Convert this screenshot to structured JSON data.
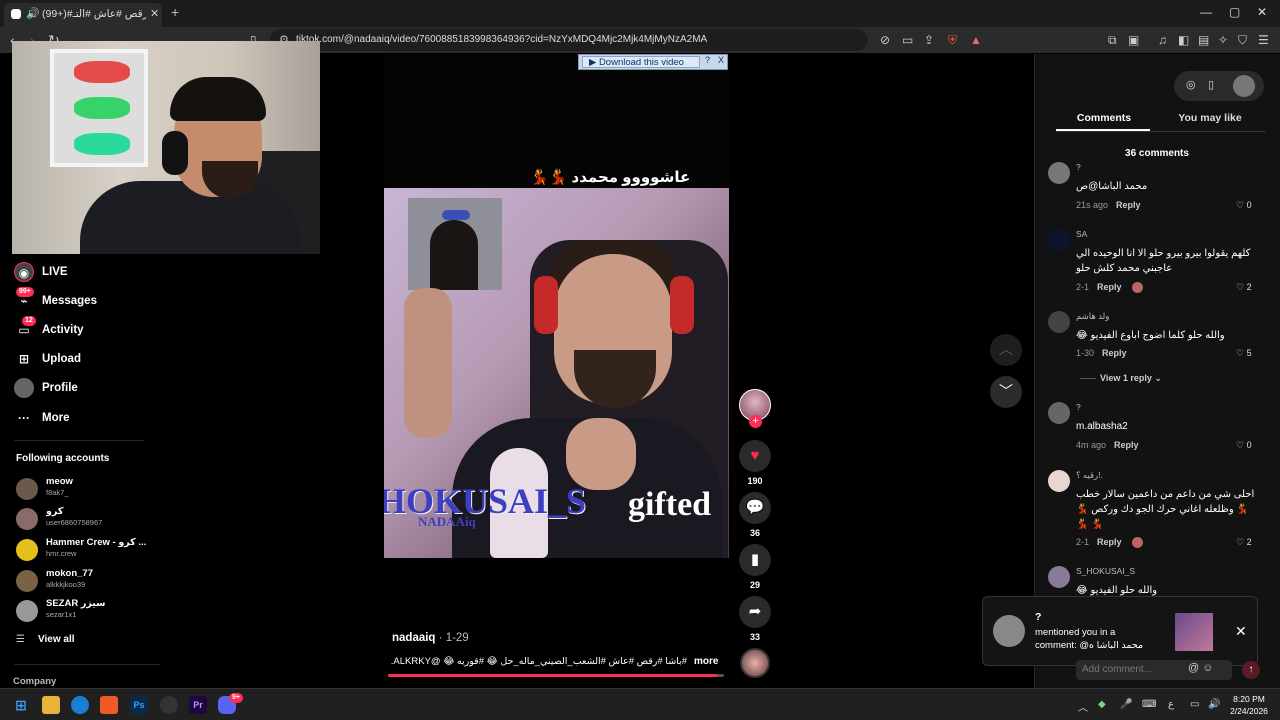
{
  "browser": {
    "tab_title": "(99+)#باشا #رقص #عاش #التـ",
    "new_tab_symbol": "+",
    "url": "tiktok.com/@nadaaiq/video/7600885183998364936?cid=NzYxMDQ4Mjc2Mjk4MjMyNzA2MA",
    "window_controls": [
      "—",
      "▢",
      "✕"
    ]
  },
  "download_bar": {
    "label": "▶ Download this video",
    "help": "?",
    "close": "X"
  },
  "sidebar": {
    "nav": [
      {
        "label": "LIVE",
        "icon": "live-icon"
      },
      {
        "label": "Messages",
        "icon": "messages-icon",
        "badge": "99+"
      },
      {
        "label": "Activity",
        "icon": "activity-icon",
        "badge": "12"
      },
      {
        "label": "Upload",
        "icon": "upload-icon"
      },
      {
        "label": "Profile",
        "icon": "profile-icon"
      },
      {
        "label": "More",
        "icon": "more-icon"
      }
    ],
    "following_heading": "Following accounts",
    "accounts": [
      {
        "name": "meow",
        "handle": "f8ak7_"
      },
      {
        "name": "كرو",
        "handle": "user6860758967"
      },
      {
        "name": "Hammer Crew - كرو ...",
        "handle": "hmr.crew"
      },
      {
        "name": "mokon_77",
        "handle": "alkkkjkoo39"
      },
      {
        "name": "SEZAR سيزر",
        "handle": "sezar1x1"
      }
    ],
    "view_all": "View all",
    "company": "Company"
  },
  "video": {
    "overlay_caption": "عاشوووو محمدد 💃💃",
    "overlay_text_left": "HOKUSAI_S",
    "overlay_text_right": "gifted",
    "overlay_text_small": "NADAAiq",
    "author": "nadaaiq",
    "date": " · 1-29",
    "description": "#باشا #رقص #عاش #الشعب_الصيني_ماله_حل 😂 #قوريه 😂 @ALKRKY...",
    "more": "more",
    "progress": 0.98
  },
  "actions": {
    "likes": "190",
    "comments": "36",
    "saves": "29",
    "shares": "33"
  },
  "comments_panel": {
    "tab_comments": "Comments",
    "tab_like": "You may like",
    "count_label": "36 comments",
    "reply_label": "Reply",
    "view_replies": "View 1 reply",
    "items": [
      {
        "user": "?",
        "text": "محمد الباشا@ص",
        "time": "21s ago",
        "likes": "0"
      },
      {
        "user": "SA",
        "text": "كلهم يقولوا بيرو بيرو حلو الا انا الوحيده الي عاجبني محمد كلش حلو",
        "time": "2-1",
        "likes": "2"
      },
      {
        "user": "ولد هاشم",
        "text": "والله حلو كلما اضوج اباوع الفيديو 😂",
        "time": "1-30",
        "likes": "5"
      },
      {
        "user": "?",
        "text": "m.albasha2",
        "time": "4m ago",
        "likes": "0"
      },
      {
        "user": "رقيه ؟!.",
        "text": "احلى شي من داعم من داعمين سالار خطب 💃 وظلعله اغاني حرك الجو دك وركص 💃 💃 💃",
        "time": "2-1",
        "likes": "2"
      },
      {
        "user": "S_HOKUSAI_S",
        "text": "والله حلو الفيديو 😂",
        "time": "",
        "likes": ""
      }
    ],
    "add_comment_placeholder": "Add comment..."
  },
  "notification": {
    "user": "?",
    "line1": "mentioned you in a",
    "line2": "comment: @محمد الباشا ه"
  },
  "taskbar": {
    "time": "8:20 PM",
    "date": "2/24/2026",
    "lang": "ع",
    "ps_label": "Ps",
    "pr_label": "Pr",
    "discord_badge": "9+"
  }
}
